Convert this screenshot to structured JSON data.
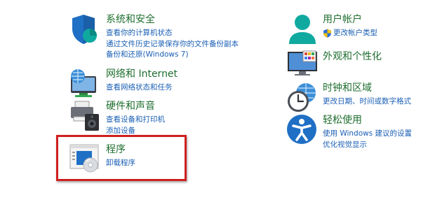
{
  "colors": {
    "title_green": "#1e6e2e",
    "link_blue": "#1a5fb4",
    "highlight_red": "#cf1f1f"
  },
  "categories": {
    "system_security": {
      "icon": "shield-icon",
      "title": "系统和安全",
      "links": [
        "查看你的计算机状态",
        "通过文件历史记录保存你的文件备份副本",
        "备份和还原(Windows 7)"
      ]
    },
    "network_internet": {
      "icon": "network-globe-icon",
      "title": "网络和 Internet",
      "links": [
        "查看网络状态和任务"
      ]
    },
    "hardware_sound": {
      "icon": "printer-speaker-icon",
      "title": "硬件和声音",
      "links": [
        "查看设备和打印机",
        "添加设备"
      ]
    },
    "programs": {
      "icon": "programs-disc-icon",
      "title": "程序",
      "links": [
        "卸载程序"
      ]
    },
    "user_accounts": {
      "icon": "user-icon",
      "title": "用户帐户",
      "links": [
        "更改帐户类型"
      ]
    },
    "appearance": {
      "icon": "monitor-personalize-icon",
      "title": "外观和个性化",
      "links": []
    },
    "clock_region": {
      "icon": "clock-globe-icon",
      "title": "时钟和区域",
      "links": [
        "更改日期、时间或数字格式"
      ]
    },
    "ease_of_access": {
      "icon": "accessibility-icon",
      "title": "轻松使用",
      "links": [
        "使用 Windows 建议的设置",
        "优化视觉显示"
      ]
    }
  }
}
